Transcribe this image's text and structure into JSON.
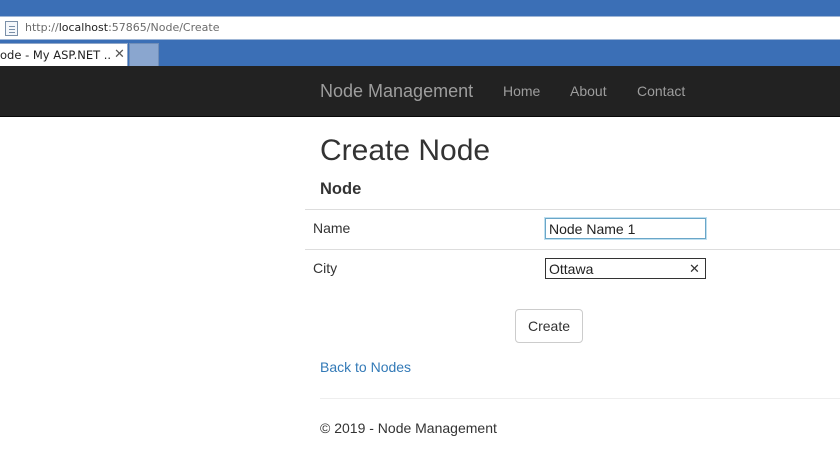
{
  "browser": {
    "url_prefix": "http://",
    "url_host": "localhost",
    "url_rest": ":57865/Node/Create",
    "tab_title": "ode - My ASP.NET ...",
    "tab_close": "✕"
  },
  "navbar": {
    "brand": "Node Management",
    "links": [
      "Home",
      "About",
      "Contact"
    ]
  },
  "main": {
    "title": "Create Node",
    "section": "Node",
    "fields": [
      {
        "label": "Name",
        "value": "Node Name 1"
      },
      {
        "label": "City",
        "value": "Ottawa"
      }
    ],
    "clear_icon": "✕",
    "create_label": "Create",
    "back_link": "Back to Nodes"
  },
  "footer": {
    "text": "© 2019 - Node Management"
  },
  "colors": {
    "browser_chrome": "#3b6fb6",
    "navbar_bg": "#222222",
    "nav_text": "#9d9d9d",
    "link": "#337ab7"
  }
}
